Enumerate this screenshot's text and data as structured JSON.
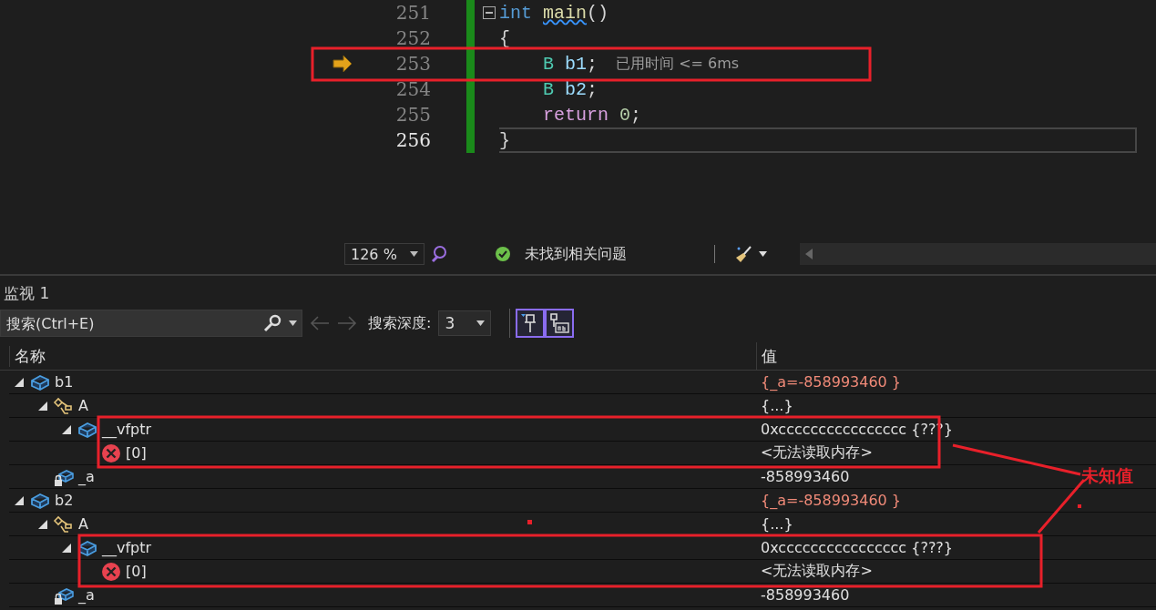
{
  "editor": {
    "lines": [
      {
        "number": "251",
        "current": false,
        "execution_pointer": false,
        "collapse": true,
        "indented": false,
        "tokens": [
          {
            "kind": "keyword",
            "text": "int"
          },
          {
            "kind": "function",
            "text": "main"
          },
          {
            "kind": "punct",
            "text": "()"
          }
        ]
      },
      {
        "number": "252",
        "current": false,
        "execution_pointer": false,
        "collapse": false,
        "indented": false,
        "tokens": [
          {
            "kind": "punct",
            "text": "{"
          }
        ]
      },
      {
        "number": "253",
        "current": false,
        "execution_pointer": true,
        "collapse": false,
        "indented": true,
        "hint": "已用时间 <= 6ms",
        "tokens": [
          {
            "kind": "type",
            "text": "B"
          },
          {
            "kind": "variable",
            "text": "b1"
          },
          {
            "kind": "punct",
            "text": ";"
          }
        ]
      },
      {
        "number": "254",
        "current": false,
        "execution_pointer": false,
        "collapse": false,
        "indented": true,
        "tokens": [
          {
            "kind": "type",
            "text": "B"
          },
          {
            "kind": "variable",
            "text": "b2"
          },
          {
            "kind": "punct",
            "text": ";"
          }
        ]
      },
      {
        "number": "255",
        "current": false,
        "execution_pointer": false,
        "collapse": false,
        "indented": true,
        "tokens": [
          {
            "kind": "control",
            "text": "return"
          },
          {
            "kind": "number",
            "text": "0"
          },
          {
            "kind": "punct",
            "text": ";"
          }
        ]
      },
      {
        "number": "256",
        "current": true,
        "execution_pointer": false,
        "collapse": false,
        "indented": false,
        "tokens": [
          {
            "kind": "punct",
            "text": "}"
          }
        ]
      }
    ]
  },
  "status_bar": {
    "zoom": "126 %",
    "issues": "未找到相关问题"
  },
  "watch": {
    "title": "监视 1",
    "search": {
      "placeholder": "搜索(Ctrl+E)"
    },
    "depth_label": "搜索深度:",
    "depth": "3",
    "toggles": [
      {
        "kind": "pin-filter",
        "selected": true
      },
      {
        "kind": "pin-text",
        "selected": true
      }
    ],
    "columns": [
      "名称",
      "值"
    ],
    "rows": [
      {
        "name": "b1",
        "kind": "object",
        "value": "{_a=-858993460 }",
        "changed": true,
        "expanded": true,
        "children": [
          {
            "name": "A",
            "kind": "base",
            "value": "{...}",
            "changed": false,
            "expanded": true,
            "children": [
              {
                "name": "__vfptr",
                "kind": "object",
                "value": "0xcccccccccccccccc {???}",
                "changed": false,
                "expanded": true,
                "children": [
                  {
                    "name": "[0]",
                    "kind": "error",
                    "value": "<无法读取内存>",
                    "changed": false,
                    "expanded": false
                  }
                ]
              }
            ]
          },
          {
            "name": "_a",
            "kind": "private-field",
            "value": "-858993460",
            "changed": false,
            "expanded": false
          }
        ]
      },
      {
        "name": "b2",
        "kind": "object",
        "value": "{_a=-858993460 }",
        "changed": true,
        "expanded": true,
        "children": [
          {
            "name": "A",
            "kind": "base",
            "value": "{...}",
            "changed": false,
            "expanded": true,
            "children": [
              {
                "name": "__vfptr",
                "kind": "object",
                "value": "0xcccccccccccccccc {???}",
                "changed": false,
                "expanded": true,
                "children": [
                  {
                    "name": "[0]",
                    "kind": "error",
                    "value": "<无法读取内存>",
                    "changed": false,
                    "expanded": false
                  }
                ]
              }
            ]
          },
          {
            "name": "_a",
            "kind": "private-field",
            "value": "-858993460",
            "changed": false,
            "expanded": false
          }
        ]
      }
    ]
  },
  "annotation": {
    "label": "未知值"
  }
}
